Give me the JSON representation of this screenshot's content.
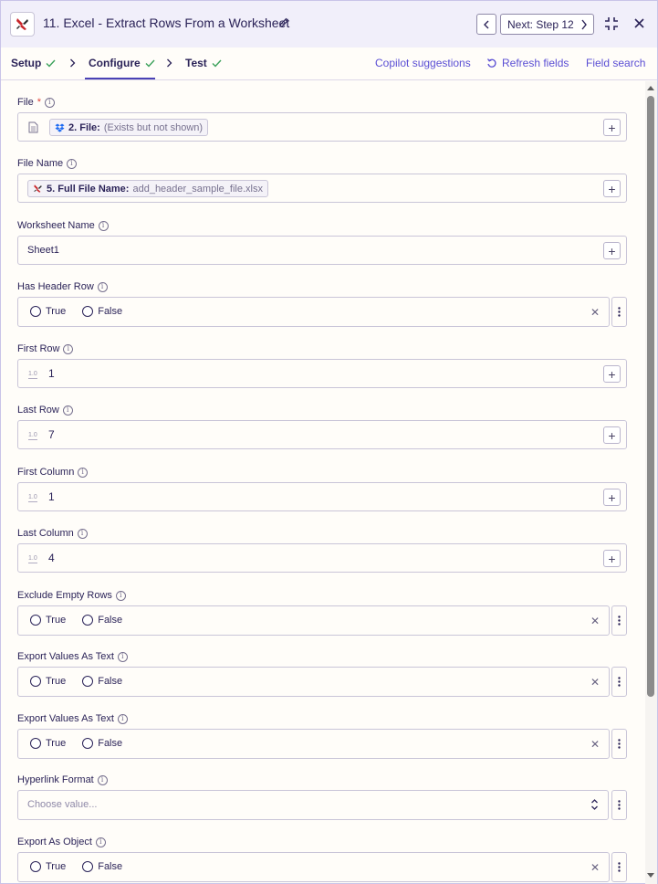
{
  "header": {
    "title": "11. Excel - Extract Rows From a Worksheet",
    "next_label": "Next: Step 12"
  },
  "tabs": [
    {
      "label": "Setup"
    },
    {
      "label": "Configure"
    },
    {
      "label": "Test"
    }
  ],
  "links": {
    "copilot": "Copilot suggestions",
    "refresh": "Refresh fields",
    "search": "Field search"
  },
  "fields": {
    "file": {
      "label": "File",
      "required": "*",
      "chip_key": "2. File:",
      "chip_value": "(Exists but not shown)"
    },
    "file_name": {
      "label": "File Name",
      "chip_key": "5. Full File Name:",
      "chip_value": "add_header_sample_file.xlsx"
    },
    "worksheet_name": {
      "label": "Worksheet Name",
      "value": "Sheet1"
    },
    "has_header_row": {
      "label": "Has Header Row"
    },
    "first_row": {
      "label": "First Row",
      "badge": "1.0",
      "value": "1"
    },
    "last_row": {
      "label": "Last Row",
      "badge": "1.0",
      "value": "7"
    },
    "first_column": {
      "label": "First Column",
      "badge": "1.0",
      "value": "1"
    },
    "last_column": {
      "label": "Last Column",
      "badge": "1.0",
      "value": "4"
    },
    "exclude_empty_rows": {
      "label": "Exclude Empty Rows"
    },
    "export_values_as_text_1": {
      "label": "Export Values As Text"
    },
    "export_values_as_text_2": {
      "label": "Export Values As Text"
    },
    "hyperlink_format": {
      "label": "Hyperlink Format",
      "placeholder": "Choose value..."
    },
    "export_as_object": {
      "label": "Export As Object"
    }
  },
  "radio": {
    "true_label": "True",
    "false_label": "False"
  },
  "colors": {
    "accent": "#5b4fd4",
    "check": "#3aa15a",
    "brand": "#c8262b"
  }
}
